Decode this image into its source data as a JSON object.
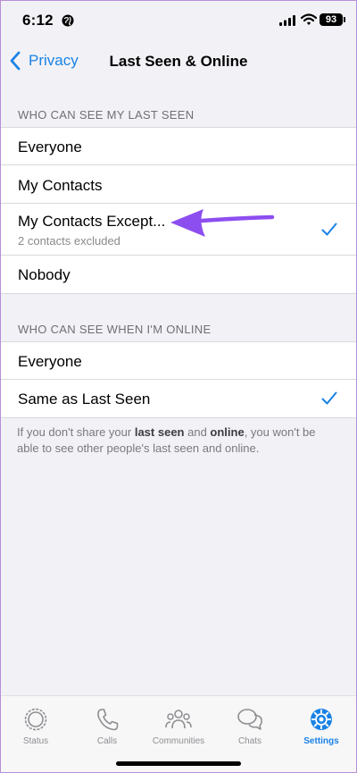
{
  "status_bar": {
    "time": "6:12",
    "battery": "93"
  },
  "nav": {
    "back_label": "Privacy",
    "title": "Last Seen & Online"
  },
  "last_seen": {
    "header": "WHO CAN SEE MY LAST SEEN",
    "options": [
      {
        "label": "Everyone",
        "subtitle": "",
        "selected": false
      },
      {
        "label": "My Contacts",
        "subtitle": "",
        "selected": false
      },
      {
        "label": "My Contacts Except...",
        "subtitle": "2 contacts excluded",
        "selected": true
      },
      {
        "label": "Nobody",
        "subtitle": "",
        "selected": false
      }
    ]
  },
  "online": {
    "header": "WHO CAN SEE WHEN I'M ONLINE",
    "options": [
      {
        "label": "Everyone",
        "selected": false
      },
      {
        "label": "Same as Last Seen",
        "selected": true
      }
    ]
  },
  "footer": {
    "prefix": "If you don't share your ",
    "bold1": "last seen",
    "middle": " and ",
    "bold2": "online",
    "suffix": ", you won't be able to see other people's last seen and online."
  },
  "tabs": [
    {
      "label": "Status",
      "icon": "status-icon",
      "active": false
    },
    {
      "label": "Calls",
      "icon": "phone-icon",
      "active": false
    },
    {
      "label": "Communities",
      "icon": "communities-icon",
      "active": false
    },
    {
      "label": "Chats",
      "icon": "chats-icon",
      "active": false
    },
    {
      "label": "Settings",
      "icon": "gear-icon",
      "active": true
    }
  ],
  "colors": {
    "accent": "#1982e6",
    "background": "#f2f2f6",
    "annotation_arrow": "#8d4ef0"
  }
}
